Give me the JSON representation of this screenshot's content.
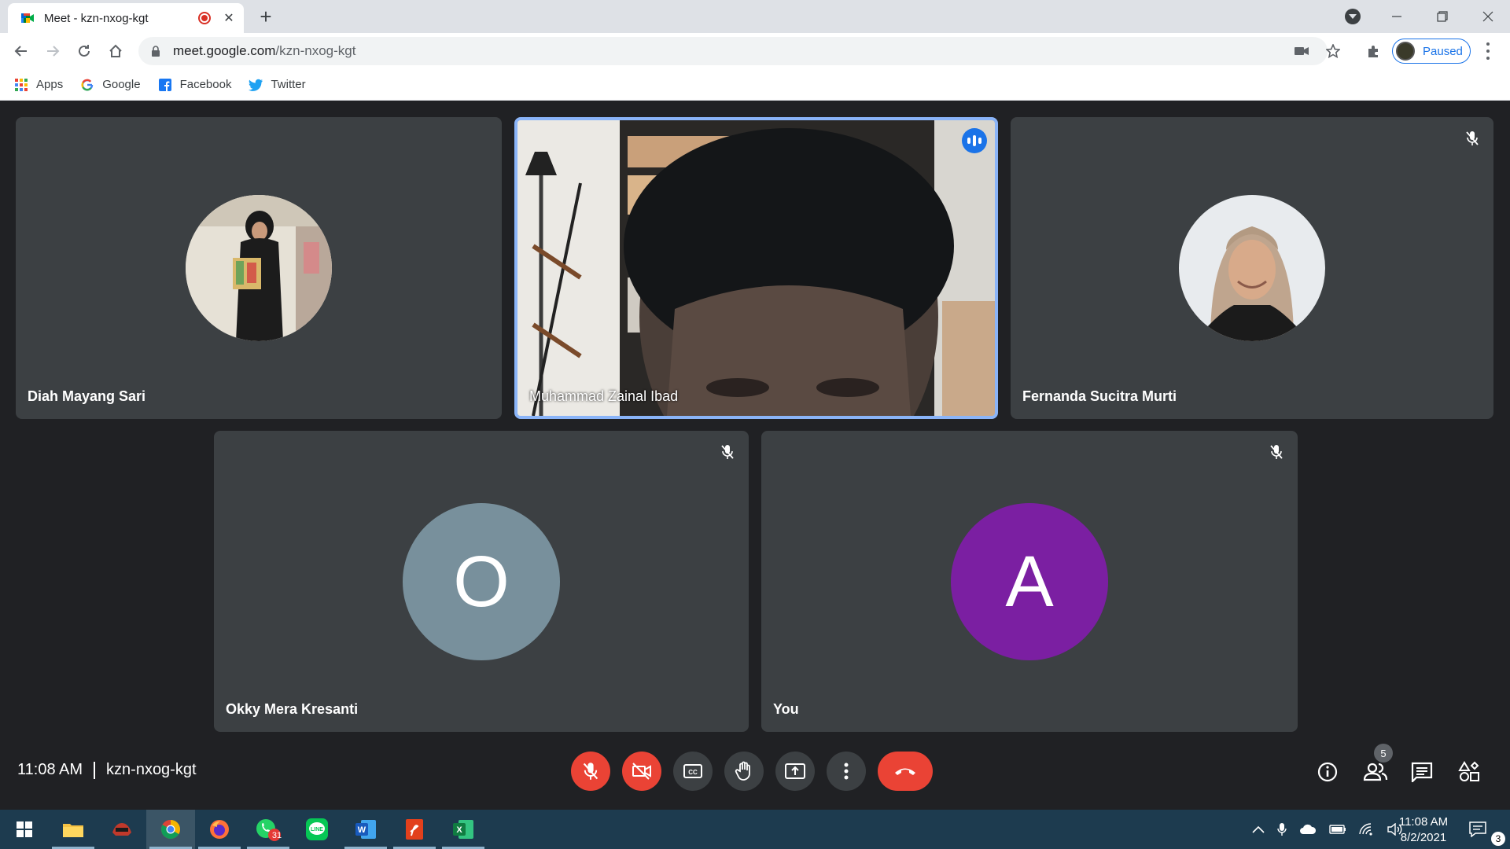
{
  "browser": {
    "tab_title": "Meet - kzn-nxog-kgt",
    "url_host": "meet.google.com",
    "url_path": "/kzn-nxog-kgt",
    "profile_label": "Paused",
    "bookmarks": [
      {
        "label": "Apps",
        "icon": "apps-grid-icon"
      },
      {
        "label": "Google",
        "icon": "google-icon"
      },
      {
        "label": "Facebook",
        "icon": "facebook-icon"
      },
      {
        "label": "Twitter",
        "icon": "twitter-icon"
      }
    ]
  },
  "meeting": {
    "time": "11:08 AM",
    "code": "kzn-nxog-kgt",
    "participant_count": "5",
    "participants": [
      {
        "name": "Diah Mayang Sari",
        "avatar": "photo",
        "muted": false
      },
      {
        "name": "Muhammad Zainal Ibad",
        "avatar": "video",
        "speaking": true
      },
      {
        "name": "Fernanda Sucitra Murti",
        "avatar": "photo",
        "muted": true
      },
      {
        "name": "Okky Mera Kresanti",
        "avatar_letter": "O",
        "avatar_color": "#78909c",
        "muted": true
      },
      {
        "name": "You",
        "avatar_letter": "A",
        "avatar_color": "#7b1fa2",
        "muted": true
      }
    ]
  },
  "controls": {
    "mic": "mic-off-icon",
    "camera": "camera-off-icon",
    "captions": "closed-captions-icon",
    "hand": "raise-hand-icon",
    "present": "present-screen-icon",
    "more": "more-options-icon",
    "leave": "leave-call-icon"
  },
  "taskbar": {
    "whatsapp_badge": "31",
    "clock_time": "11:08 AM",
    "clock_date": "8/2/2021",
    "notifications": "3"
  },
  "colors": {
    "accent_blue": "#1a73e8",
    "meet_red": "#ea4335",
    "tile_bg": "#3c4043",
    "page_bg": "#202124"
  }
}
